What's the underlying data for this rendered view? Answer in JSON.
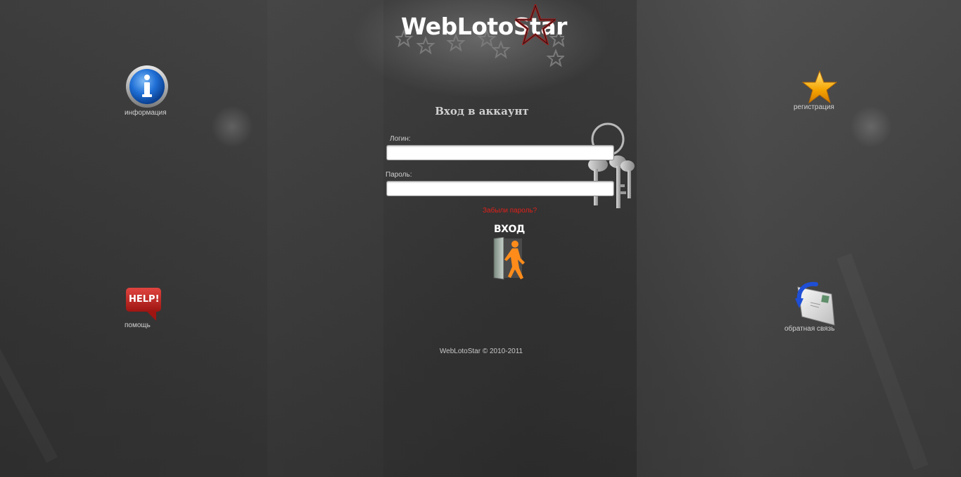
{
  "logo": {
    "text": "WebLotoStar"
  },
  "nav": {
    "info_label": "информация",
    "register_label": "регистрация",
    "help_label": "помощь",
    "help_badge": "HELP!",
    "feedback_label": "обратная связь"
  },
  "login": {
    "title": "Вход в аккаунт",
    "login_label": "Логин:",
    "login_value": "",
    "password_label": "Пароль:",
    "password_value": "",
    "forgot_link": "Забыли пароль?",
    "submit_label": "ВХОД"
  },
  "footer": {
    "copyright": "WebLotoStar © 2010-2011"
  },
  "colors": {
    "background": "#3a3a3a",
    "text": "#cfcfcf",
    "forgot_link": "#e0201a",
    "info_icon_blue": "#1f6fd6",
    "star_icon_orange": "#f5a400",
    "help_badge_red": "#c4221f",
    "enter_figure_orange": "#ff8c1a"
  },
  "icons": {
    "logo_emblem": "pentagram-star-icon",
    "info": "info-icon",
    "register": "star-icon",
    "help": "help-bubble-icon",
    "feedback": "envelope-reply-icon",
    "keys": "keys-icon",
    "enter": "door-person-icon"
  }
}
